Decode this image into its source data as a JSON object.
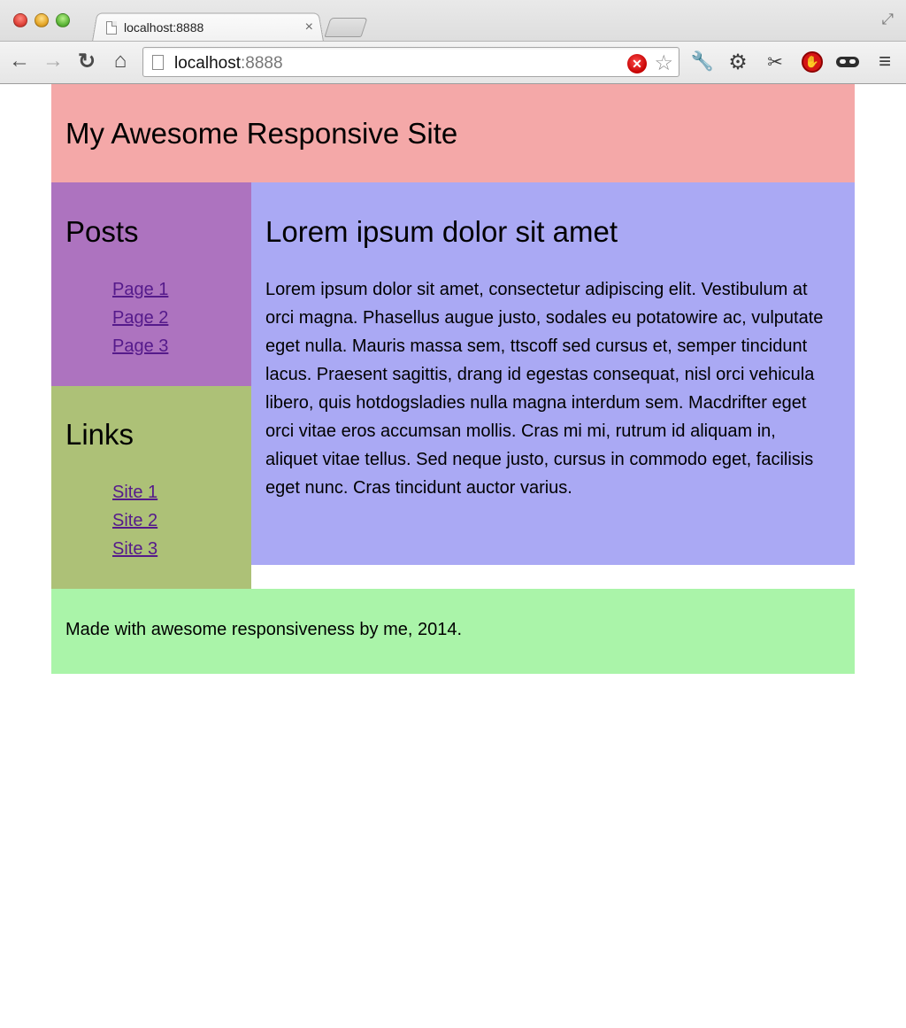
{
  "browser": {
    "tab": {
      "title": "localhost:8888",
      "close_glyph": "×"
    },
    "nav": {
      "back_glyph": "←",
      "forward_glyph": "→",
      "reload_glyph": "↻",
      "home_glyph": "⌂"
    },
    "omnibox": {
      "host": "localhost",
      "port": ":8888",
      "ext_glyph": "✕",
      "star_glyph": "☆"
    },
    "toolbar_icons": {
      "wrench_glyph": "🔧",
      "gear_glyph": "⚙",
      "robot_glyph": "✂",
      "stop_glyph": "✋",
      "menu_glyph": "≡",
      "fullscreen_glyph": "⤢"
    }
  },
  "site": {
    "header": {
      "title": "My Awesome Responsive Site"
    },
    "posts": {
      "heading": "Posts",
      "items": [
        {
          "label": "Page 1"
        },
        {
          "label": "Page 2"
        },
        {
          "label": "Page 3"
        }
      ]
    },
    "links": {
      "heading": "Links",
      "items": [
        {
          "label": "Site 1"
        },
        {
          "label": "Site 2"
        },
        {
          "label": "Site 3"
        }
      ]
    },
    "article": {
      "title": "Lorem ipsum dolor sit amet",
      "body": "Lorem ipsum dolor sit amet, consectetur adipiscing elit. Vestibulum at orci magna. Phasellus augue justo, sodales eu potatowire ac, vulputate eget nulla. Mauris massa sem, ttscoff sed cursus et, semper tincidunt lacus. Praesent sagittis, drang id egestas consequat, nisl orci vehicula libero, quis hotdogsladies nulla magna interdum sem. Macdrifter eget orci vitae eros accumsan mollis. Cras mi mi, rutrum id aliquam in, aliquet vitae tellus. Sed neque justo, cursus in commodo eget, facilisis eget nunc. Cras tincidunt auctor varius."
    },
    "footer": {
      "text": "Made with awesome responsiveness by me, 2014."
    }
  },
  "colors": {
    "header_bg": "#f4a8a8",
    "posts_bg": "#ad73bf",
    "links_bg": "#adc177",
    "main_bg": "#aaa9f4",
    "footer_bg": "#aaf4a9",
    "link_color": "#551a8b"
  }
}
